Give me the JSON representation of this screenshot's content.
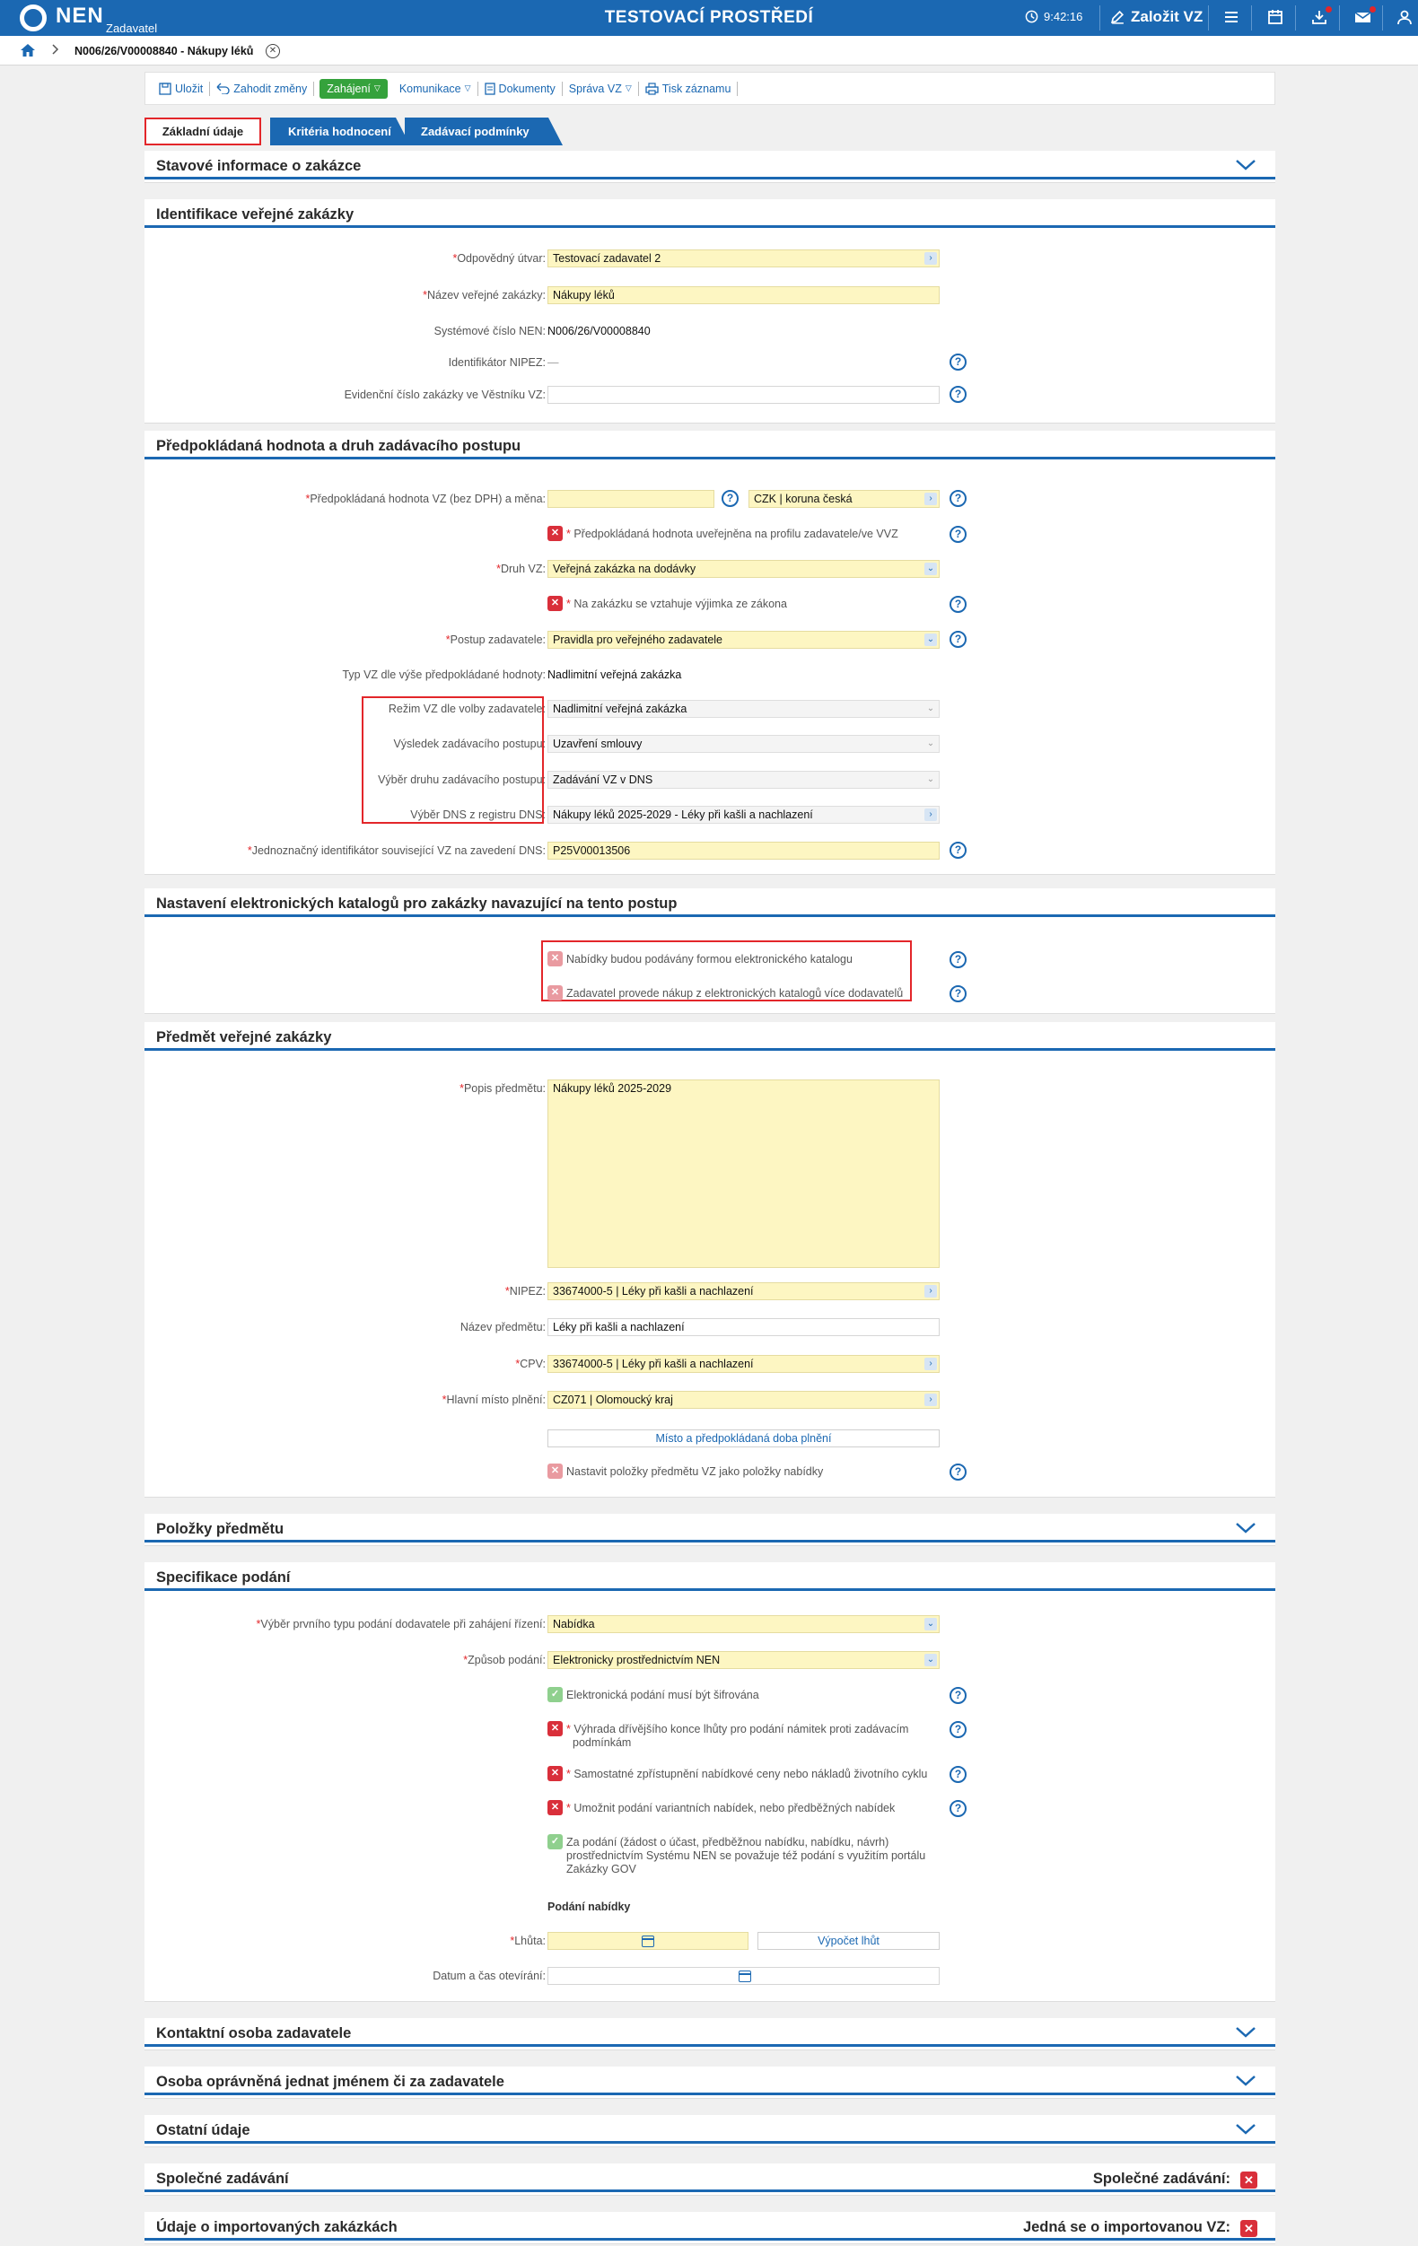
{
  "topbar": {
    "logo": "NEN",
    "role": "Zadavatel",
    "environment": "TESTOVACÍ PROSTŘEDÍ",
    "time": "9:42:16",
    "create_button": "Založit VZ",
    "icons": [
      "menu-icon",
      "calendar-icon",
      "download-icon",
      "mail-icon",
      "user-icon"
    ]
  },
  "breadcrumb": {
    "item": "N006/26/V00008840 - Nákupy léků"
  },
  "toolbar": {
    "save": "Uložit",
    "discard": "Zahodit změny",
    "start": "Zahájení",
    "communication": "Komunikace",
    "documents": "Dokumenty",
    "manage": "Správa VZ",
    "print": "Tisk záznamu"
  },
  "tabs": [
    "Základní údaje",
    "Kritéria hodnocení",
    "Zadávací podmínky"
  ],
  "sections": {
    "status": "Stavové informace o zakázce",
    "ident": "Identifikace veřejné zakázky",
    "value": "Předpokládaná hodnota a druh zadávacího postupu",
    "catalog": "Nastavení elektronických katalogů pro zakázky navazující na tento postup",
    "subject": "Předmět veřejné zakázky",
    "items": "Položky předmětu",
    "submission": "Specifikace podání",
    "contact": "Kontaktní osoba zadavatele",
    "authorized": "Osoba oprávněná jednat jménem či za zadavatele",
    "other": "Ostatní údaje",
    "joint": "Společné zadávání",
    "imported": "Údaje o importovaných zakázkách"
  },
  "ident": {
    "unit_label": "Odpovědný útvar:",
    "unit_value": "Testovací zadavatel 2",
    "name_label": "Název veřejné zakázky:",
    "name_value": "Nákupy léků",
    "sysno_label": "Systémové číslo NEN:",
    "sysno_value": "N006/26/V00008840",
    "nipez_label": "Identifikátor NIPEZ:",
    "nipez_value": "—",
    "evid_label": "Evidenční číslo zakázky ve Věstníku VZ:",
    "evid_value": ""
  },
  "value": {
    "estimate_label": "Předpokládaná hodnota VZ (bez DPH) a měna:",
    "estimate_value": "",
    "currency": "CZK | koruna česká",
    "published_text": "Předpokládaná hodnota uveřejněna na profilu zadavatele/ve VVZ",
    "type_label": "Druh VZ:",
    "type_value": "Veřejná zakázka na dodávky",
    "exemption_text": "Na zakázku se vztahuje výjimka ze zákona",
    "procedure_label": "Postup zadavatele:",
    "procedure_value": "Pravidla pro veřejného zadavatele",
    "typevz_label": "Typ VZ dle výše předpokládané hodnoty:",
    "typevz_value": "Nadlimitní veřejná zakázka",
    "mode_label": "Režim VZ dle volby zadavatele:",
    "mode_value": "Nadlimitní veřejná zakázka",
    "result_label": "Výsledek zadávacího postupu:",
    "result_value": "Uzavření smlouvy",
    "kind_label": "Výběr druhu zadávacího postupu:",
    "kind_value": "Zadávání VZ v DNS",
    "dns_label": "Výběr DNS z registru DNS:",
    "dns_value": "Nákupy léků 2025-2029 - Léky při kašli a nachlazení",
    "uid_label": "Jednoznačný identifikátor související VZ na zavedení DNS:",
    "uid_value": "P25V00013506"
  },
  "catalog": {
    "opt1": "Nabídky budou podávány formou elektronického katalogu",
    "opt2": "Zadavatel provede nákup z elektronických katalogů více dodavatelů"
  },
  "subject": {
    "desc_label": "Popis předmětu:",
    "desc_value": "Nákupy léků 2025-2029",
    "nipez_label": "NIPEZ:",
    "nipez_value": "33674000-5 | Léky při kašli a nachlazení",
    "name_label": "Název předmětu:",
    "name_value": "Léky při kašli a nachlazení",
    "cpv_label": "CPV:",
    "cpv_value": "33674000-5 | Léky při kašli a nachlazení",
    "place_label": "Hlavní místo plnění:",
    "place_value": "CZ071 | Olomoucký kraj",
    "place_button": "Místo a předpokládaná doba plnění",
    "items_text": "Nastavit položky předmětu VZ jako položky nabídky"
  },
  "submission": {
    "first_label": "Výběr prvního typu podání dodavatele při zahájení řízení:",
    "first_value": "Nabídka",
    "method_label": "Způsob podání:",
    "method_value": "Elektronicky prostřednictvím NEN",
    "encrypt_text": "Elektronická podání musí být šifrována",
    "reserve_text_1": "Výhrada dřívějšího konce lhůty pro podání námitek proti zadávacím",
    "reserve_text_2": "podmínkám",
    "separate_text": "Samostatné zpřístupnění nabídkové ceny nebo nákladů životního cyklu",
    "variant_text": "Umožnit podání variantních nabídek, nebo předběžných nabídek",
    "gov_text_1": "Za podání (žádost o účast, předběžnou nabídku, nabídku, návrh)",
    "gov_text_2": "prostřednictvím Systému NEN se považuje též podání s využitím portálu",
    "gov_text_3": "Zakázky GOV",
    "offer_heading": "Podání nabídky",
    "deadline_label": "Lhůta:",
    "deadline_button": "Výpočet lhůt",
    "open_label": "Datum a čas otevírání:"
  },
  "joint": {
    "label": "Společné zadávání:"
  },
  "imported": {
    "label": "Jedná se o importovanou VZ:"
  }
}
